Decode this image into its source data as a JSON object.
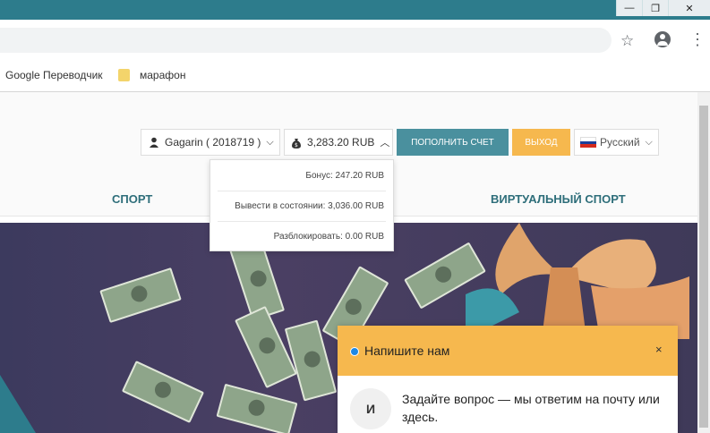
{
  "browser": {
    "window_controls": {
      "minimize": "—",
      "restore": "❐",
      "close": "✕"
    },
    "star_icon": "☆",
    "kebab_icon": "⋮",
    "bookmarks": [
      {
        "label": "Google Переводчик"
      },
      {
        "label": "марафон"
      }
    ]
  },
  "header": {
    "user_label": "Gagarin ( 2018719 )",
    "balance_label": "3,283.20 RUB",
    "deposit_button": "ПОПОЛНИТЬ СЧЕТ",
    "exit_button": "ВЫХОД",
    "language": "Русский"
  },
  "balance_dropdown": {
    "bonus": "Бонус: 247.20 RUB",
    "withdrawable": "Вывести в состоянии: 3,036.00 RUB",
    "unlock": "Разблокировать: 0.00 RUB"
  },
  "nav": {
    "sport": "СПОРТ",
    "virtual_sport": "ВИРТУАЛЬНЫЙ СПОРТ"
  },
  "chat": {
    "title": "Напишите нам",
    "close": "×",
    "avatar_letter": "И",
    "message": "Задайте вопрос — мы ответим на почту или здесь."
  },
  "colors": {
    "titlebar": "#2d7c8c",
    "deposit": "#4a909e",
    "exit": "#f6b84e",
    "nav_text": "#2e6e7a",
    "chat_header": "#f6b84e"
  }
}
